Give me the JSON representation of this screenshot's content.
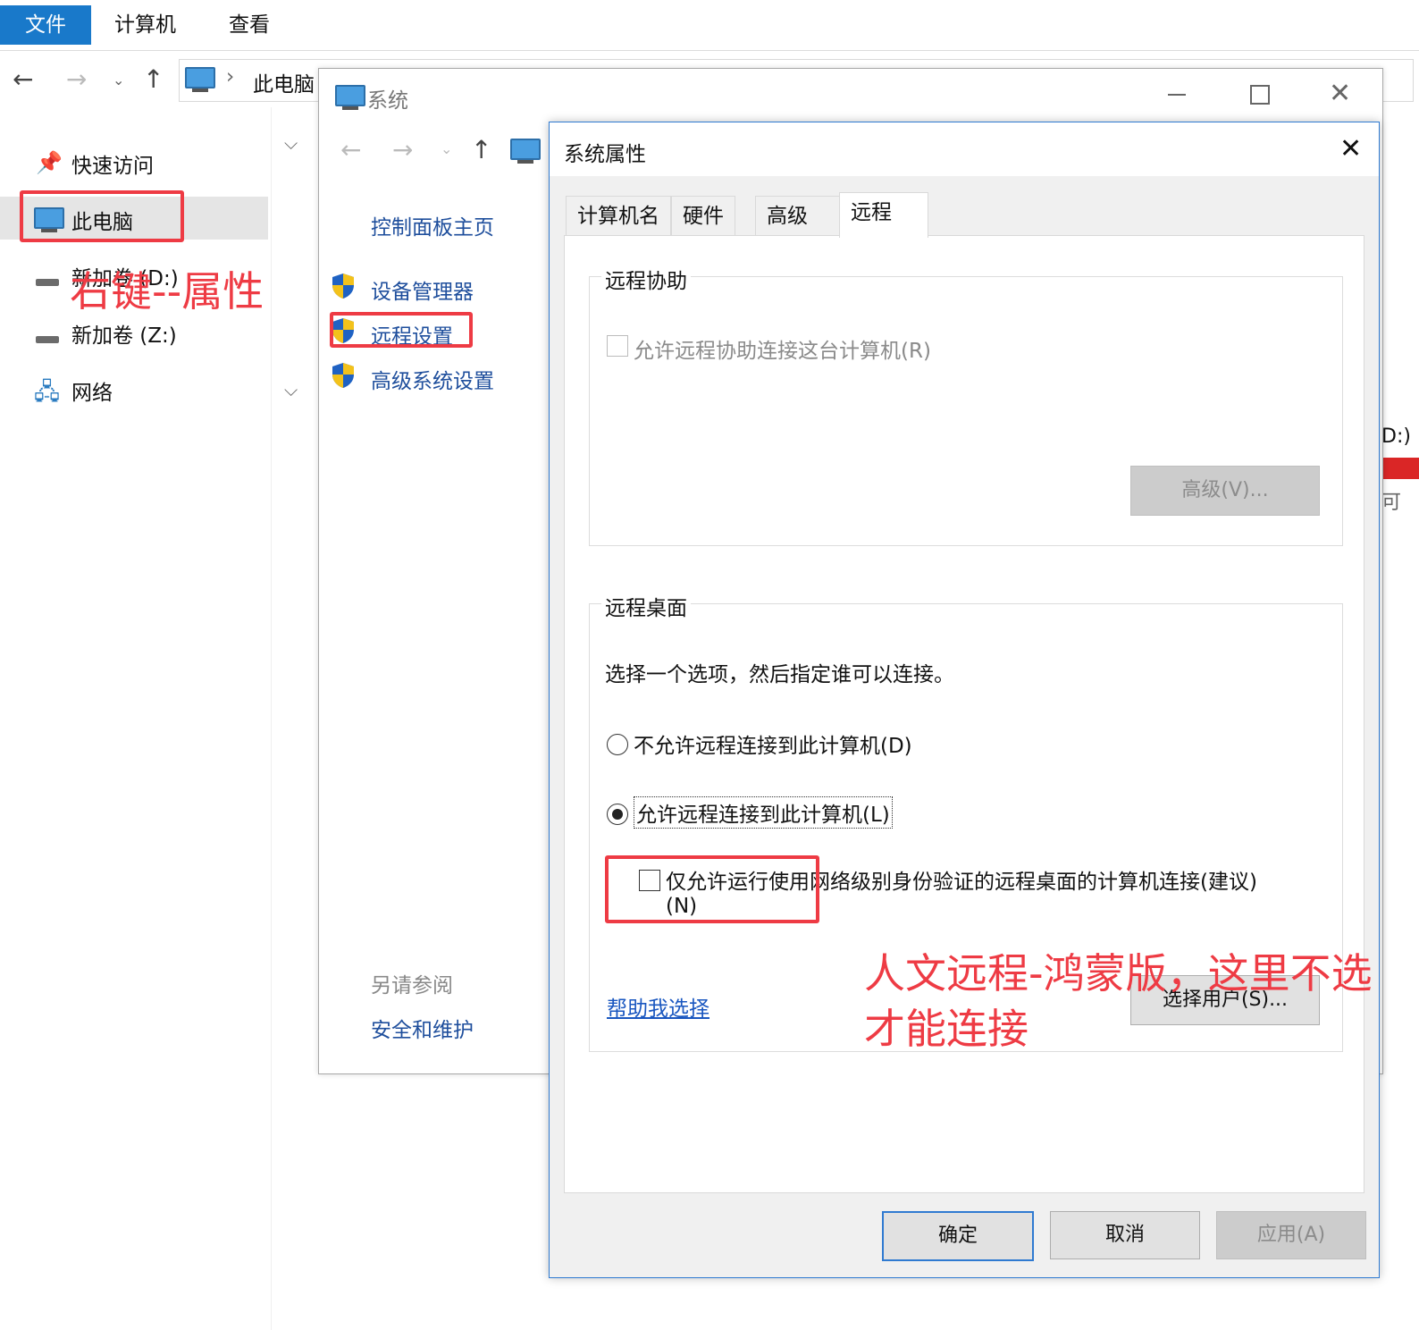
{
  "explorer": {
    "ribbon_tabs": [
      "文件",
      "计算机",
      "查看"
    ],
    "breadcrumb": "此电脑",
    "sidebar": {
      "quick_access": "快速访问",
      "this_pc": "此电脑",
      "drive_d": "新加卷 (D:)",
      "drive_z": "新加卷 (Z:)",
      "network": "网络"
    },
    "right_edge_fragments": [
      "D:)",
      "可"
    ]
  },
  "system_window": {
    "title": "系统",
    "links": {
      "control_panel_home": "控制面板主页",
      "device_manager": "设备管理器",
      "remote_settings": "远程设置",
      "advanced_settings": "高级系统设置"
    },
    "see_also": "另请参阅",
    "security_maintenance": "安全和维护"
  },
  "dialog": {
    "title": "系统属性",
    "tabs": [
      "计算机名",
      "硬件",
      "高级",
      "远程"
    ],
    "remote_assistance": {
      "group_label": "远程协助",
      "allow_label": "允许远程协助连接这台计算机(R)",
      "allow_checked": false,
      "advanced_button": "高级(V)..."
    },
    "remote_desktop": {
      "group_label": "远程桌面",
      "instruction": "选择一个选项，然后指定谁可以连接。",
      "option_deny": "不允许远程连接到此计算机(D)",
      "option_allow": "允许远程连接到此计算机(L)",
      "selected": "allow",
      "nla_label_line1": "仅允许运行使用网络级别身份验证的远程桌面的计算机连接(建议)",
      "nla_label_line2": "(N)",
      "nla_checked": false,
      "help_link": "帮助我选择",
      "select_users_button": "选择用户(S)..."
    },
    "buttons": {
      "ok": "确定",
      "cancel": "取消",
      "apply": "应用(A)"
    }
  },
  "annotations": {
    "right_click": "右键--属性",
    "note_line1": "人文远程-鸿蒙版，这里不选",
    "note_line2": "才能连接"
  },
  "colors": {
    "accent": "#1979ca",
    "annotation": "#ee3b44",
    "link": "#1e4e9c"
  }
}
